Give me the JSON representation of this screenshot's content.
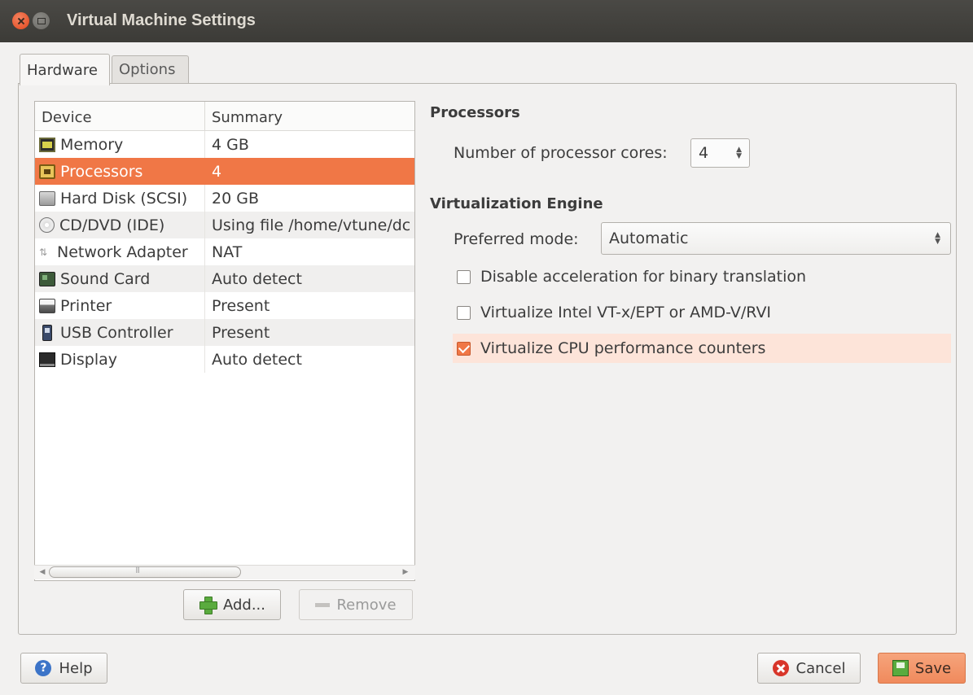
{
  "window": {
    "title": "Virtual Machine Settings"
  },
  "tabs": [
    {
      "label": "Hardware",
      "active": true
    },
    {
      "label": "Options",
      "active": false
    }
  ],
  "device_list": {
    "columns": [
      "Device",
      "Summary"
    ],
    "rows": [
      {
        "device": "Memory",
        "summary": "4 GB",
        "icon": "memory-icon"
      },
      {
        "device": "Processors",
        "summary": "4",
        "icon": "processor-icon",
        "selected": true
      },
      {
        "device": "Hard Disk (SCSI)",
        "summary": "20 GB",
        "icon": "hard-disk-icon"
      },
      {
        "device": "CD/DVD (IDE)",
        "summary": "Using file /home/vtune/dc",
        "icon": "cd-dvd-icon"
      },
      {
        "device": "Network Adapter",
        "summary": "NAT",
        "icon": "network-adapter-icon"
      },
      {
        "device": "Sound Card",
        "summary": "Auto detect",
        "icon": "sound-card-icon"
      },
      {
        "device": "Printer",
        "summary": "Present",
        "icon": "printer-icon"
      },
      {
        "device": "USB Controller",
        "summary": "Present",
        "icon": "usb-controller-icon"
      },
      {
        "device": "Display",
        "summary": "Auto detect",
        "icon": "display-icon"
      }
    ]
  },
  "list_buttons": {
    "add": "Add...",
    "remove": "Remove"
  },
  "processors": {
    "section_title": "Processors",
    "cores_label": "Number of processor cores:",
    "cores_value": "4"
  },
  "virtualization": {
    "section_title": "Virtualization Engine",
    "mode_label": "Preferred mode:",
    "mode_value": "Automatic",
    "options": [
      {
        "label": "Disable acceleration for binary translation",
        "checked": false
      },
      {
        "label": "Virtualize Intel VT-x/EPT or AMD-V/RVI",
        "checked": false
      },
      {
        "label": "Virtualize CPU performance counters",
        "checked": true
      }
    ]
  },
  "footer": {
    "help": "Help",
    "cancel": "Cancel",
    "save": "Save"
  },
  "colors": {
    "accent": "#f07746",
    "titlebar": "#3c3b37",
    "highlight_row": "#fde4d9"
  }
}
